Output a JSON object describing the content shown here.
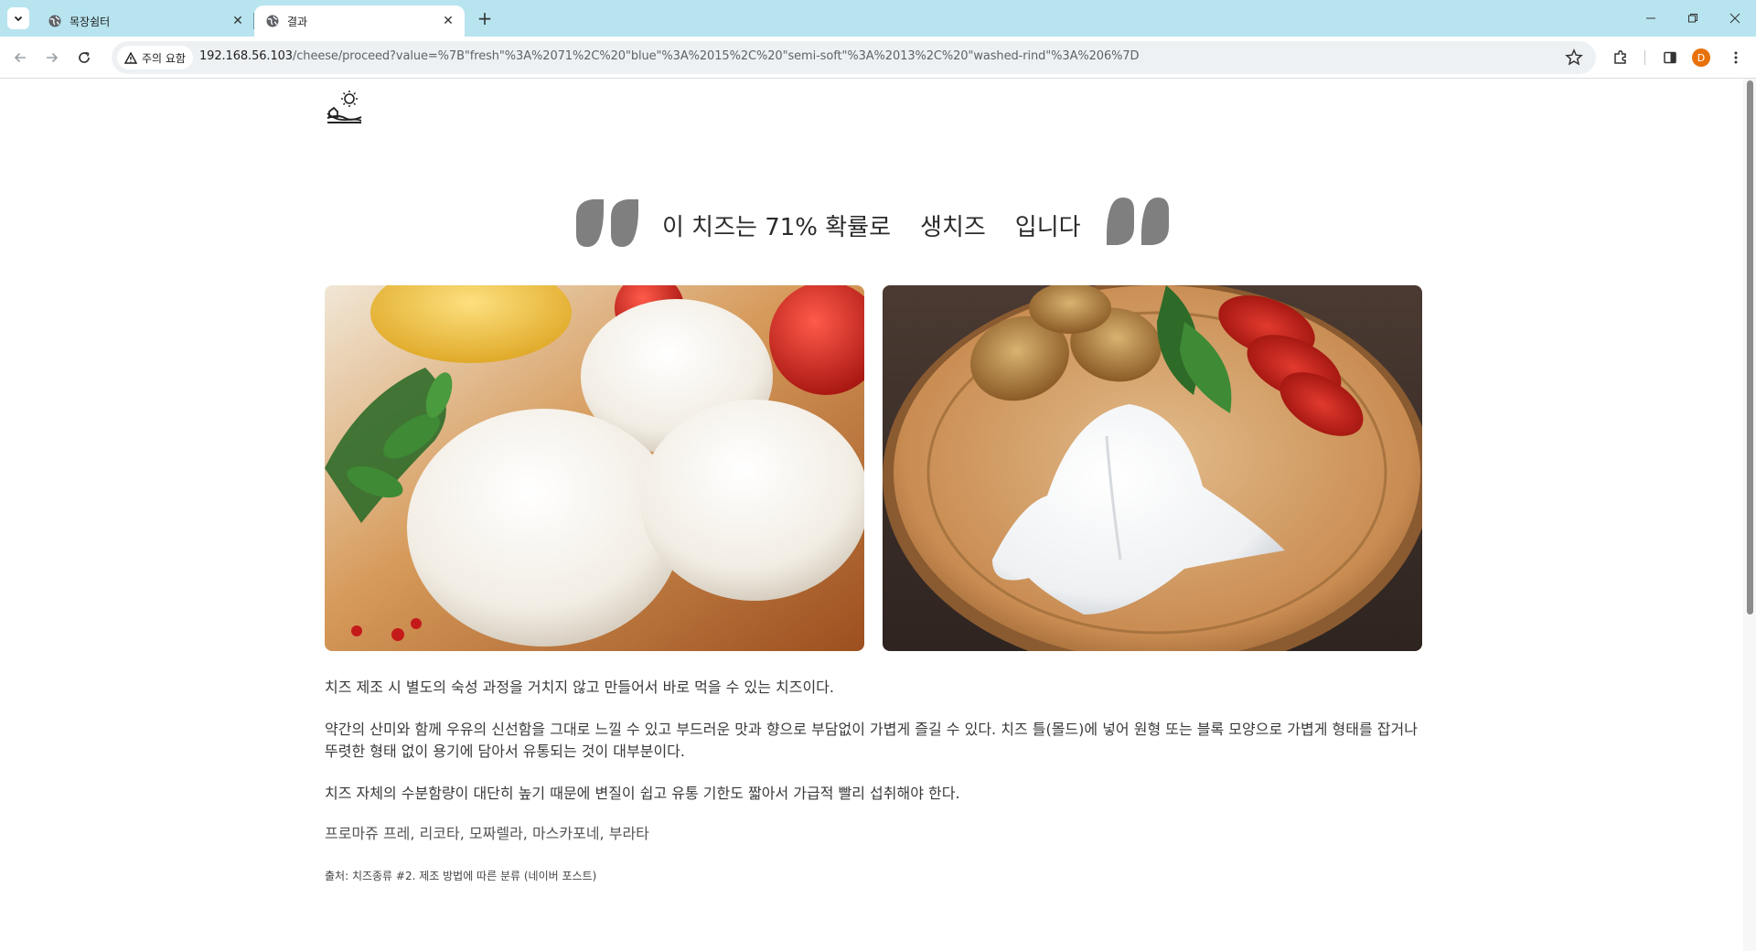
{
  "browser": {
    "tabs": [
      {
        "title": "목장쉼터",
        "active": false
      },
      {
        "title": "결과",
        "active": true
      }
    ],
    "security_chip": "주의 요함",
    "url_host": "192.168.56.103",
    "url_path": "/cheese/proceed?value=%7B\"fresh\"%3A%2071%2C%20\"blue\"%3A%2015%2C%20\"semi-soft\"%3A%2013%2C%20\"washed-rind\"%3A%206%7D",
    "profile_initial": "D",
    "accent": "#b7e4ef"
  },
  "result": {
    "prefix": "이 치즈는 71% 확률로",
    "cheese_type": "생치즈",
    "suffix": "입니다",
    "highlight_color": "#fbe1e1"
  },
  "images": [
    {
      "name": "mozzarella-photo"
    },
    {
      "name": "burrata-photo"
    }
  ],
  "description": {
    "p1": "치즈 제조 시 별도의 숙성 과정을 거치지 않고 만들어서 바로 먹을 수 있는 치즈이다.",
    "p2": "약간의 산미와 함께 우유의 신선함을 그대로 느낄 수 있고 부드러운 맛과 향으로 부담없이 가볍게 즐길 수 있다. 치즈 틀(몰드)에 넣어 원형 또는 블록 모양으로 가볍게 형태를 잡거나 뚜렷한 형태 없이 용기에 담아서 유통되는 것이 대부분이다.",
    "p3": "치즈 자체의 수분함량이 대단히 높기 때문에 변질이 쉽고 유통 기한도 짧아서 가급적 빨리 섭취해야 한다.",
    "examples": "프로마쥬 프레, 리코타, 모짜렐라, 마스카포네, 부라타",
    "source": "출처: 치즈종류 #2. 제조 방법에 따른 분류 (네이버 포스트)"
  }
}
